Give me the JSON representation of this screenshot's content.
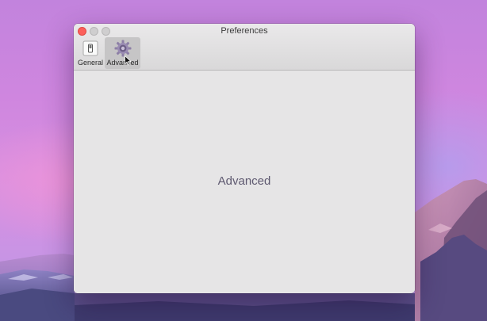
{
  "window": {
    "title": "Preferences",
    "controls": [
      "close",
      "minimize",
      "zoom"
    ]
  },
  "toolbar": {
    "items": [
      {
        "label": "General",
        "icon": "switch-icon",
        "selected": false
      },
      {
        "label": "Advanced",
        "icon": "gear-icon",
        "selected": true
      }
    ]
  },
  "content": {
    "label": "Advanced"
  },
  "colors": {
    "close": "#fc605b",
    "selected_tab_bg": "#c6c5c6",
    "content_bg": "#e6e5e6",
    "content_text": "#5e5970"
  }
}
